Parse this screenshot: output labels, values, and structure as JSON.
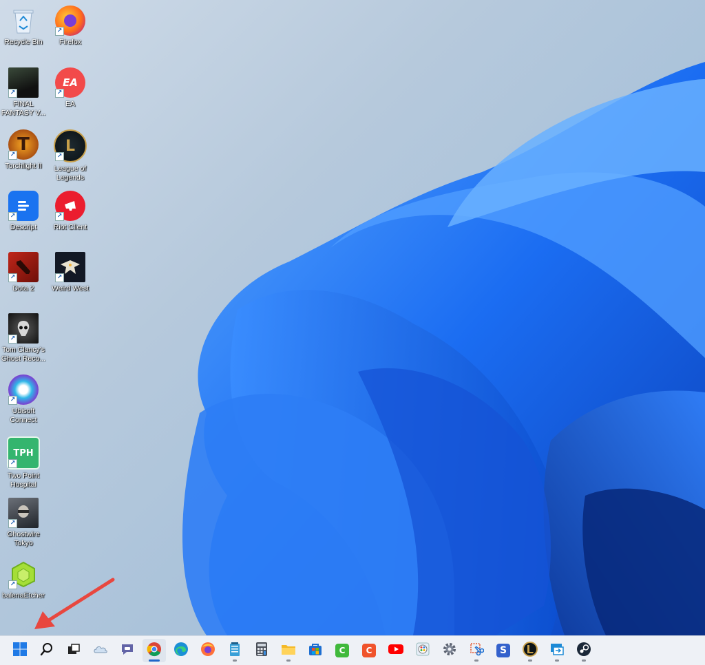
{
  "desktop": {
    "icons": [
      {
        "label": "Recycle Bin",
        "icon": "recycle-bin-icon"
      },
      {
        "label": "Firefox",
        "icon": "firefox-icon"
      },
      {
        "label": "FINAL FANTASY V...",
        "icon": "final-fantasy-icon"
      },
      {
        "label": "EA",
        "icon": "ea-icon"
      },
      {
        "label": "Torchlight II",
        "icon": "torchlight-icon"
      },
      {
        "label": "League of Legends",
        "icon": "league-of-legends-icon"
      },
      {
        "label": "Descript",
        "icon": "descript-icon"
      },
      {
        "label": "Riot Client",
        "icon": "riot-client-icon"
      },
      {
        "label": "Dota 2",
        "icon": "dota2-icon"
      },
      {
        "label": "Weird West",
        "icon": "weird-west-icon"
      },
      {
        "label": "Tom Clancy's Ghost Reco...",
        "icon": "ghost-recon-icon"
      },
      {
        "label": "Ubisoft Connect",
        "icon": "ubisoft-connect-icon"
      },
      {
        "label": "Two Point Hospital",
        "icon": "two-point-hospital-icon"
      },
      {
        "label": "Ghostwire Tokyo",
        "icon": "ghostwire-tokyo-icon"
      },
      {
        "label": "balenaEtcher",
        "icon": "balena-etcher-icon"
      }
    ],
    "icon_text": {
      "ea": "EA",
      "tph": "TPH",
      "torchlight": "T"
    }
  },
  "taskbar": {
    "items": [
      {
        "name": "start-button",
        "icon": "windows-logo-icon"
      },
      {
        "name": "search-button",
        "icon": "search-icon"
      },
      {
        "name": "task-view-button",
        "icon": "task-view-icon"
      },
      {
        "name": "widgets-button",
        "icon": "widgets-icon"
      },
      {
        "name": "chat-button",
        "icon": "teams-chat-icon"
      },
      {
        "name": "chrome-button",
        "icon": "chrome-icon"
      },
      {
        "name": "edge-button",
        "icon": "edge-icon"
      },
      {
        "name": "firefox-button",
        "icon": "firefox-icon"
      },
      {
        "name": "notepad-button",
        "icon": "notepad-icon"
      },
      {
        "name": "calculator-button",
        "icon": "calculator-icon"
      },
      {
        "name": "file-explorer-button",
        "icon": "folder-icon"
      },
      {
        "name": "store-button",
        "icon": "store-icon"
      },
      {
        "name": "camtasia-button",
        "icon": "camtasia-icon"
      },
      {
        "name": "camtasia-recorder-button",
        "icon": "camtasia-recorder-icon"
      },
      {
        "name": "youtube-button",
        "icon": "youtube-icon"
      },
      {
        "name": "paint-button",
        "icon": "paint-icon"
      },
      {
        "name": "settings-button",
        "icon": "gear-icon"
      },
      {
        "name": "snipping-tool-button",
        "icon": "snipping-tool-icon"
      },
      {
        "name": "simplenote-button",
        "icon": "simplenote-icon"
      },
      {
        "name": "league-button",
        "icon": "league-of-legends-icon"
      },
      {
        "name": "remote-desktop-button",
        "icon": "remote-desktop-icon"
      },
      {
        "name": "steam-button",
        "icon": "steam-icon"
      }
    ],
    "glyphs": {
      "camtasia": "C",
      "simplenote": "S"
    }
  },
  "colors": {
    "accent": "#1f66c9",
    "wallpaper_bloom": "#1a6cf0",
    "arrow": "#e8473f"
  }
}
